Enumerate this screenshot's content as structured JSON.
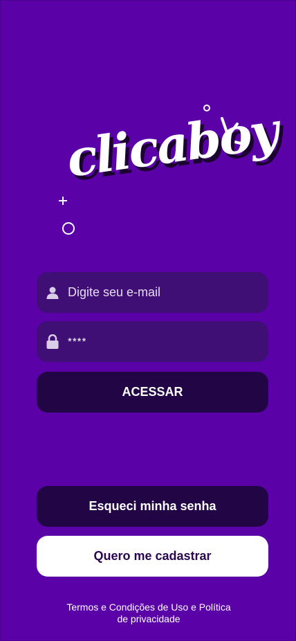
{
  "logo": {
    "text": "clicaboy",
    "icon": "clicaboy-logo"
  },
  "form": {
    "email": {
      "placeholder": "Digite seu e-mail",
      "value": "",
      "icon": "user-icon"
    },
    "password": {
      "placeholder": "",
      "value": "****",
      "icon": "lock-icon"
    },
    "login_label": "ACESSAR"
  },
  "actions": {
    "forgot_label": "Esqueci minha senha",
    "signup_label": "Quero me cadastrar"
  },
  "footer": {
    "terms_line1": "Termos e Condições de Uso e Política",
    "terms_line2": "de privacidade"
  },
  "colors": {
    "background": "#5a02a8",
    "field": "#3f0f75",
    "dark_button": "#220544",
    "light_button": "#ffffff"
  }
}
